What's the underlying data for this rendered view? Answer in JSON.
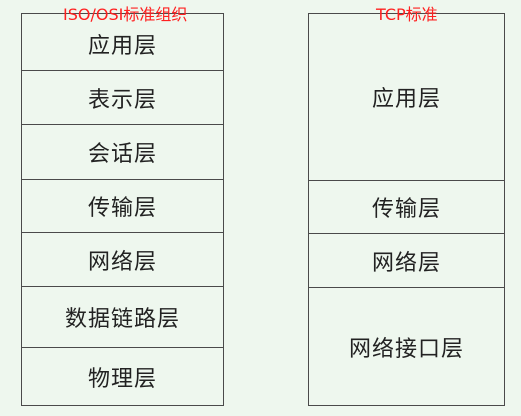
{
  "osi": {
    "title": "ISO/OSI标准组织",
    "layers": [
      "应用层",
      "表示层",
      "会话层",
      "传输层",
      "网络层",
      "数据链路层",
      "物理层"
    ]
  },
  "tcp": {
    "title": "TCP标准",
    "layers": [
      "应用层",
      "传输层",
      "网络层",
      "网络接口层"
    ]
  },
  "colors": {
    "background": "#eef7ee",
    "title": "#ff2020",
    "border": "#4a4a4a"
  }
}
